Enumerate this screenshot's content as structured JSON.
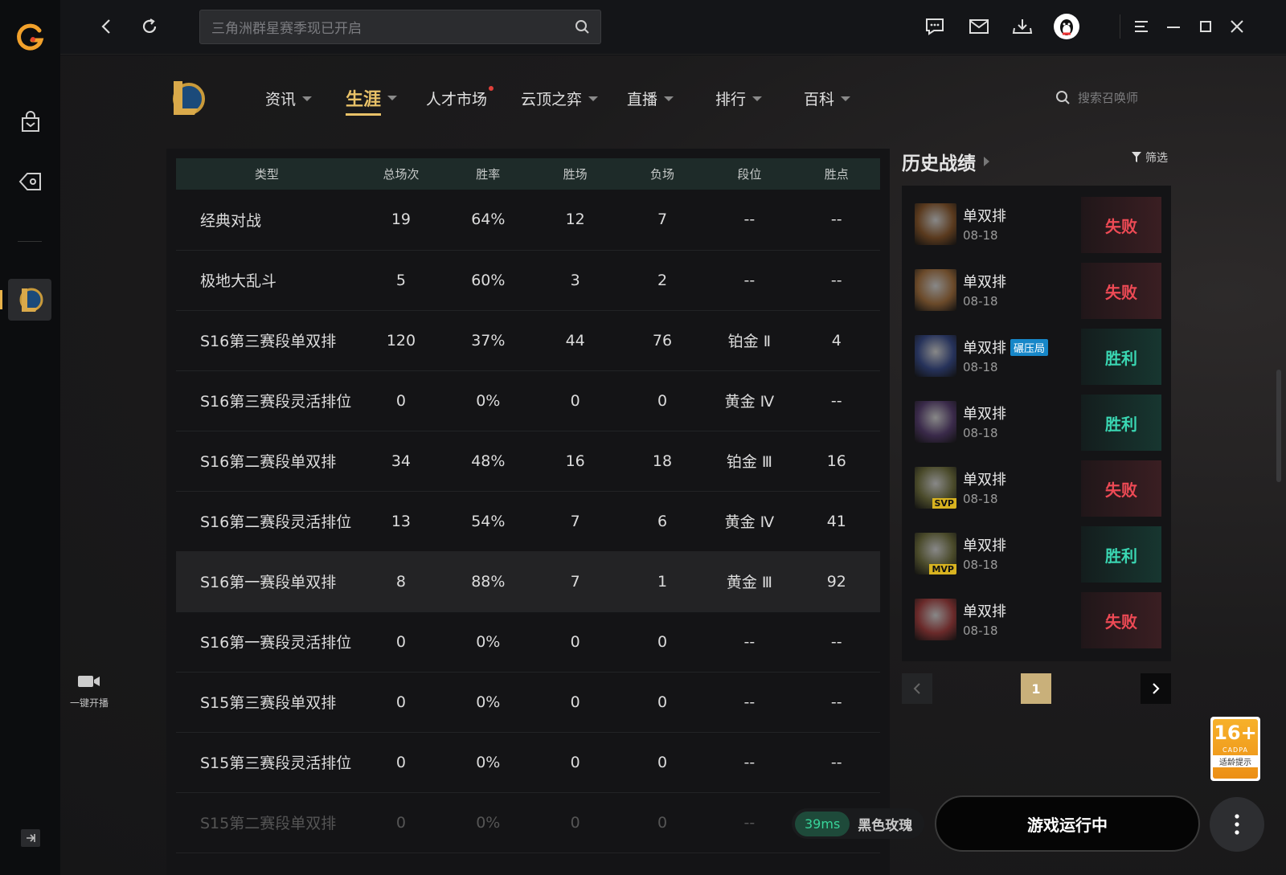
{
  "topbar": {
    "search_placeholder": "三角洲群星赛季现已开启"
  },
  "rail": {
    "live_label": "一键开播"
  },
  "game_nav": {
    "items": [
      {
        "label": "资讯"
      },
      {
        "label": "生涯"
      },
      {
        "label": "人才市场"
      },
      {
        "label": "云顶之弈"
      },
      {
        "label": "直播"
      },
      {
        "label": "排行"
      },
      {
        "label": "百科"
      }
    ],
    "summoner_search_placeholder": "搜索召唤师"
  },
  "stats": {
    "headers": [
      "类型",
      "总场次",
      "胜率",
      "胜场",
      "负场",
      "段位",
      "胜点"
    ],
    "rows": [
      [
        "经典对战",
        "19",
        "64%",
        "12",
        "7",
        "--",
        "--"
      ],
      [
        "极地大乱斗",
        "5",
        "60%",
        "3",
        "2",
        "--",
        "--"
      ],
      [
        "S16第三赛段单双排",
        "120",
        "37%",
        "44",
        "76",
        "铂金 Ⅱ",
        "4"
      ],
      [
        "S16第三赛段灵活排位",
        "0",
        "0%",
        "0",
        "0",
        "黄金 Ⅳ",
        "--"
      ],
      [
        "S16第二赛段单双排",
        "34",
        "48%",
        "16",
        "18",
        "铂金 Ⅲ",
        "16"
      ],
      [
        "S16第二赛段灵活排位",
        "13",
        "54%",
        "7",
        "6",
        "黄金 Ⅳ",
        "41"
      ],
      [
        "S16第一赛段单双排",
        "8",
        "88%",
        "7",
        "1",
        "黄金 Ⅲ",
        "92"
      ],
      [
        "S16第一赛段灵活排位",
        "0",
        "0%",
        "0",
        "0",
        "--",
        "--"
      ],
      [
        "S15第三赛段单双排",
        "0",
        "0%",
        "0",
        "0",
        "--",
        "--"
      ],
      [
        "S15第三赛段灵活排位",
        "0",
        "0%",
        "0",
        "0",
        "--",
        "--"
      ],
      [
        "S15第二赛段单双排",
        "0",
        "0%",
        "0",
        "0",
        "--",
        "--"
      ]
    ]
  },
  "history": {
    "title": "历史战绩",
    "filter_label": "筛选",
    "matches": [
      {
        "mode": "单双排",
        "date": "08-18",
        "result": "失败",
        "outcome": "loss",
        "badge": "",
        "avatar_color": "#5a3a1e"
      },
      {
        "mode": "单双排",
        "date": "08-18",
        "result": "失败",
        "outcome": "loss",
        "badge": "",
        "avatar_color": "#6b4a2a"
      },
      {
        "mode": "单双排",
        "date": "08-18",
        "result": "胜利",
        "outcome": "win",
        "badge": "碾压局",
        "avatar_color": "#26325a"
      },
      {
        "mode": "单双排",
        "date": "08-18",
        "result": "胜利",
        "outcome": "win",
        "badge": "",
        "avatar_color": "#3a2a4a"
      },
      {
        "mode": "单双排",
        "date": "08-18",
        "result": "失败",
        "outcome": "loss",
        "badge": "",
        "avatar_color": "#4a4a2a",
        "tag": "SVP"
      },
      {
        "mode": "单双排",
        "date": "08-18",
        "result": "胜利",
        "outcome": "win",
        "badge": "",
        "avatar_color": "#4a4a2a",
        "tag": "MVP"
      },
      {
        "mode": "单双排",
        "date": "08-18",
        "result": "失败",
        "outcome": "loss",
        "badge": "",
        "avatar_color": "#6a2a2a"
      }
    ],
    "current_page": "1"
  },
  "age_rating": {
    "age": "16+",
    "org": "CADPA",
    "tip": "适龄提示"
  },
  "bottom": {
    "ping": "39ms",
    "server": "黑色玫瑰",
    "game_status": "游戏运行中"
  },
  "colors": {
    "accent_gold": "#e9c268",
    "win": "#3ad6b2",
    "loss": "#ee4a55"
  }
}
